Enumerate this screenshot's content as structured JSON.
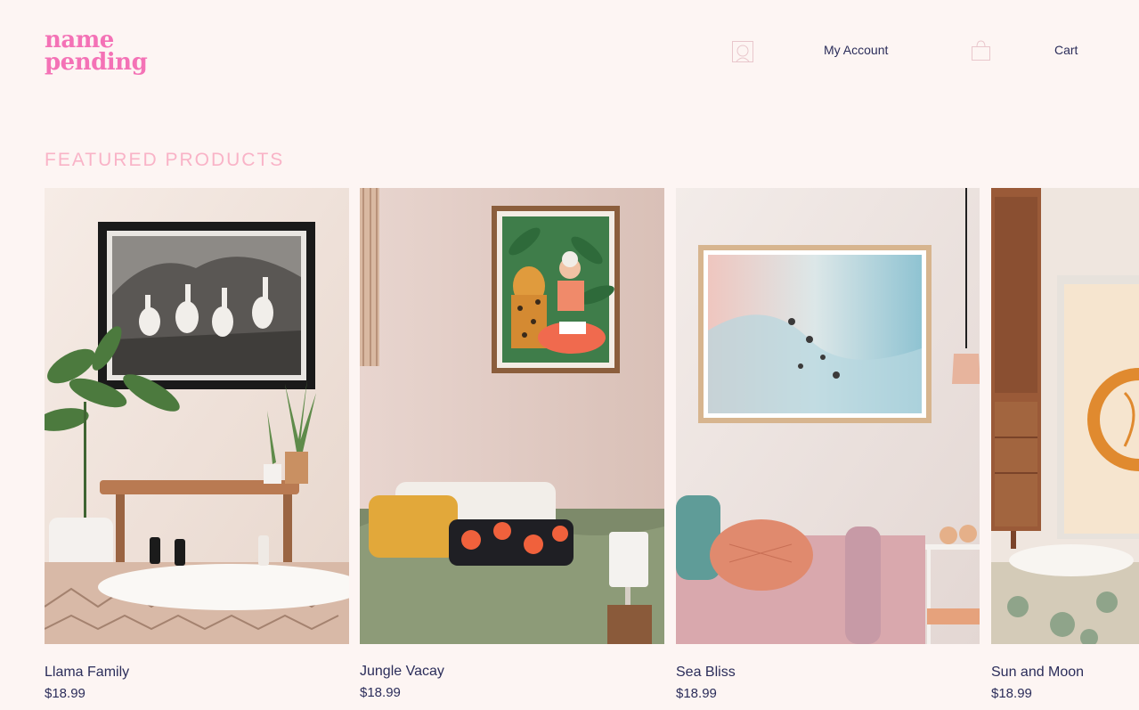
{
  "brand": {
    "line1": "name",
    "line2": "pending",
    "color": "#f472b6"
  },
  "nav": {
    "account_icon": "account-icon",
    "account_label": "My Account",
    "cart_icon": "shopping-bag-icon",
    "cart_label": "Cart"
  },
  "section": {
    "title": "FEATURED PRODUCTS"
  },
  "products": [
    {
      "name": "Llama Family",
      "price": "$18.99"
    },
    {
      "name": "Jungle Vacay",
      "price": "$18.99"
    },
    {
      "name": "Sea Bliss",
      "price": "$18.99"
    },
    {
      "name": "Sun and Moon",
      "price": "$18.99"
    }
  ],
  "colors": {
    "background": "#fdf5f3",
    "accent": "#f472b6",
    "section_title": "#f9b3c7",
    "text": "#2b2d5a"
  }
}
